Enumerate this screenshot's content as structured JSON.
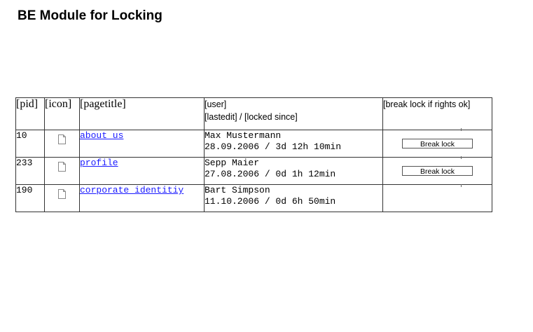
{
  "page": {
    "title": "BE Module for Locking"
  },
  "table": {
    "headers": {
      "pid": "[pid]",
      "icon": "[icon]",
      "pagetitle": "[pagetitle]",
      "user": "[user]",
      "lastedit": "[lastedit] / [locked since]",
      "break": "[break lock if rights ok]"
    },
    "rows": [
      {
        "pid": "10",
        "icon": "page-icon",
        "pagetitle": "about us",
        "user": "Max Mustermann",
        "time": "28.09.2006 / 3d 12h 10min",
        "button": "Break lock"
      },
      {
        "pid": "233",
        "icon": "page-icon",
        "pagetitle": "profile",
        "user": "Sepp Maier",
        "time": "27.08.2006 / 0d 1h 12min",
        "button": "Break lock"
      },
      {
        "pid": "190",
        "icon": "page-icon",
        "pagetitle": "corporate identitiy",
        "user": "Bart Simpson",
        "time": "11.10.2006 / 0d 6h 50min",
        "button": ""
      }
    ]
  },
  "colors": {
    "link": "#1a1aff",
    "border": "#333333"
  }
}
